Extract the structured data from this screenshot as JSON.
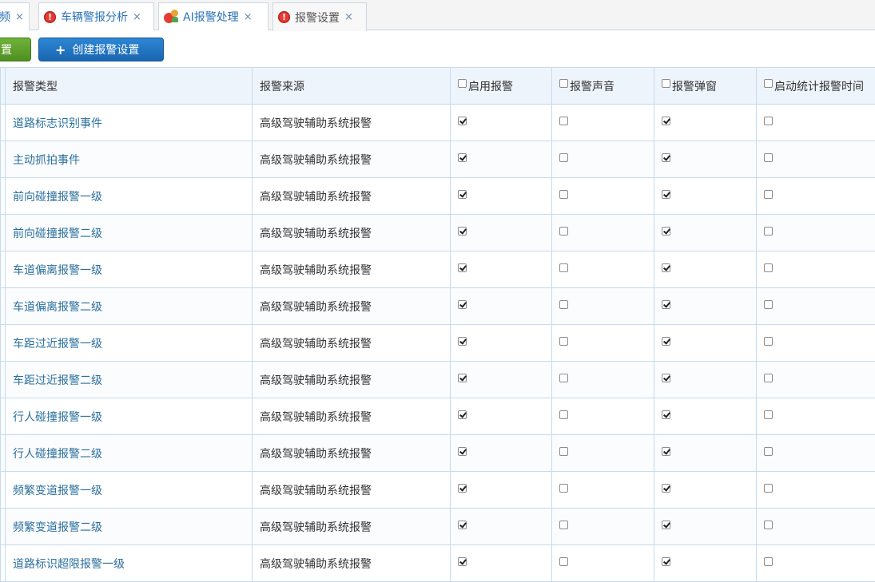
{
  "tabs": [
    {
      "label": "频",
      "close": "×",
      "icon": "none",
      "active": false
    },
    {
      "label": "车辆警报分析",
      "close": "×",
      "icon": "alert-icon",
      "active": false
    },
    {
      "label": "AI报警处理",
      "close": "×",
      "icon": "ai-user-icon",
      "active": false
    },
    {
      "label": "报警设置",
      "close": "×",
      "icon": "alert-icon",
      "active": true
    }
  ],
  "toolbar": {
    "left_button_label": "置",
    "create_button_label": "创建报警设置",
    "create_button_icon": "+"
  },
  "table": {
    "headers": {
      "type": "报警类型",
      "source": "报警来源",
      "enable": "启用报警",
      "sound": "报警声音",
      "popup": "报警弹窗",
      "stats_time": "启动统计报警时间"
    },
    "rows": [
      {
        "type": "道路标志识别事件",
        "source": "高级驾驶辅助系统报警",
        "enable": true,
        "sound": false,
        "popup": true,
        "stats": false
      },
      {
        "type": "主动抓拍事件",
        "source": "高级驾驶辅助系统报警",
        "enable": true,
        "sound": false,
        "popup": true,
        "stats": false
      },
      {
        "type": "前向碰撞报警一级",
        "source": "高级驾驶辅助系统报警",
        "enable": true,
        "sound": false,
        "popup": true,
        "stats": false
      },
      {
        "type": "前向碰撞报警二级",
        "source": "高级驾驶辅助系统报警",
        "enable": true,
        "sound": false,
        "popup": true,
        "stats": false
      },
      {
        "type": "车道偏离报警一级",
        "source": "高级驾驶辅助系统报警",
        "enable": true,
        "sound": false,
        "popup": true,
        "stats": false
      },
      {
        "type": "车道偏离报警二级",
        "source": "高级驾驶辅助系统报警",
        "enable": true,
        "sound": false,
        "popup": true,
        "stats": false
      },
      {
        "type": "车距过近报警一级",
        "source": "高级驾驶辅助系统报警",
        "enable": true,
        "sound": false,
        "popup": true,
        "stats": false
      },
      {
        "type": "车距过近报警二级",
        "source": "高级驾驶辅助系统报警",
        "enable": true,
        "sound": false,
        "popup": true,
        "stats": false
      },
      {
        "type": "行人碰撞报警一级",
        "source": "高级驾驶辅助系统报警",
        "enable": true,
        "sound": false,
        "popup": true,
        "stats": false
      },
      {
        "type": "行人碰撞报警二级",
        "source": "高级驾驶辅助系统报警",
        "enable": true,
        "sound": false,
        "popup": true,
        "stats": false
      },
      {
        "type": "频繁变道报警一级",
        "source": "高级驾驶辅助系统报警",
        "enable": true,
        "sound": false,
        "popup": true,
        "stats": false
      },
      {
        "type": "频繁变道报警二级",
        "source": "高级驾驶辅助系统报警",
        "enable": true,
        "sound": false,
        "popup": true,
        "stats": false
      },
      {
        "type": "道路标识超限报警一级",
        "source": "高级驾驶辅助系统报警",
        "enable": true,
        "sound": false,
        "popup": true,
        "stats": false
      }
    ]
  },
  "colors": {
    "link_text": "#2a6f9c",
    "tab_text": "#2a73b8",
    "header_bg": "#eef4fb",
    "grid_line": "#c6dbee",
    "create_button": "#1a66b0",
    "green_button": "#4f8f22",
    "alert_icon": "#e63b35"
  }
}
